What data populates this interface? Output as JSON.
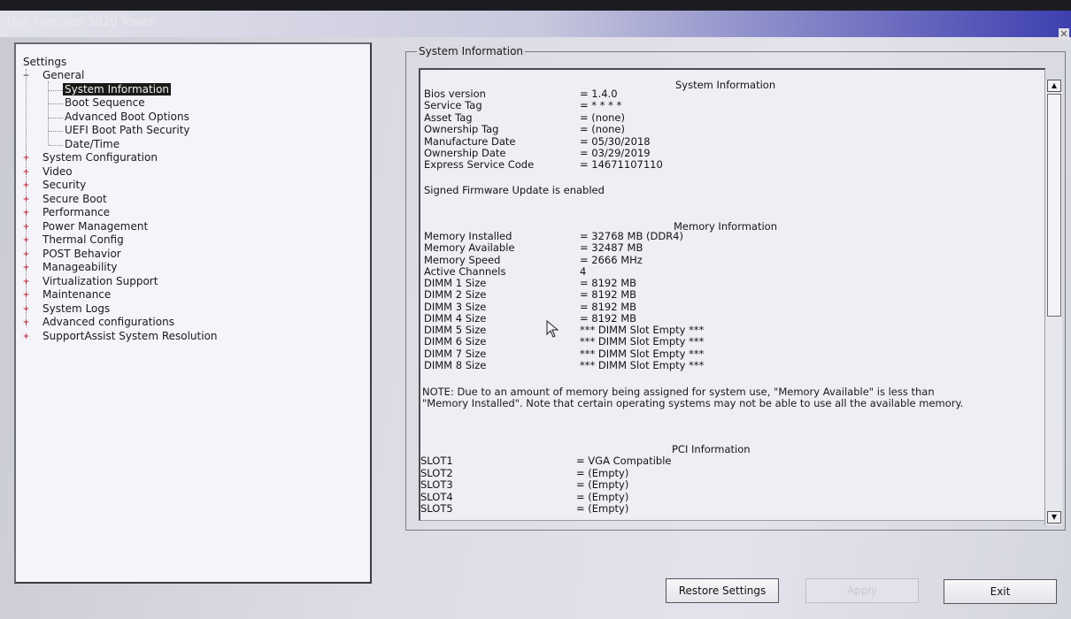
{
  "window": {
    "title": "Dell Precision 5820 Tower"
  },
  "tree": {
    "root": "Settings",
    "general": {
      "label": "General",
      "children": [
        "System Information",
        "Boot Sequence",
        "Advanced Boot Options",
        "UEFI Boot Path Security",
        "Date/Time"
      ],
      "selected": "System Information"
    },
    "items": [
      "System Configuration",
      "Video",
      "Security",
      "Secure Boot",
      "Performance",
      "Power Management",
      "Thermal Config",
      "POST Behavior",
      "Manageability",
      "Virtualization Support",
      "Maintenance",
      "System Logs",
      "Advanced configurations",
      "SupportAssist System Resolution"
    ]
  },
  "group_title": "System Information",
  "system": {
    "heading": "System Information",
    "rows": [
      [
        "Bios version",
        "= 1.4.0"
      ],
      [
        "Service Tag",
        "= * * * *"
      ],
      [
        "Asset Tag",
        "= (none)"
      ],
      [
        "Ownership Tag",
        "= (none)"
      ],
      [
        "Manufacture Date",
        "= 05/30/2018"
      ],
      [
        "Ownership Date",
        "= 03/29/2019"
      ],
      [
        "Express Service Code",
        "= 14671107110"
      ]
    ],
    "firmware_note": "Signed Firmware Update is enabled"
  },
  "memory": {
    "heading": "Memory Information",
    "rows": [
      [
        "Memory Installed",
        "= 32768 MB (DDR4)"
      ],
      [
        "Memory Available",
        "= 32487 MB"
      ],
      [
        "Memory Speed",
        "= 2666 MHz"
      ],
      [
        "Active Channels",
        "4"
      ],
      [
        "DIMM 1 Size",
        "= 8192 MB"
      ],
      [
        "DIMM 2 Size",
        "= 8192 MB"
      ],
      [
        "DIMM 3 Size",
        "= 8192 MB"
      ],
      [
        "DIMM 4 Size",
        "= 8192 MB"
      ],
      [
        "DIMM 5 Size",
        "*** DIMM Slot Empty ***"
      ],
      [
        "DIMM 6 Size",
        "*** DIMM Slot Empty ***"
      ],
      [
        "DIMM 7 Size",
        "*** DIMM Slot Empty ***"
      ],
      [
        "DIMM 8 Size",
        "*** DIMM Slot Empty ***"
      ]
    ],
    "note": "NOTE: Due to an amount of memory being assigned for system use, \"Memory Available\" is less than \"Memory Installed\". Note that certain operating systems may not be able to use all the available memory."
  },
  "pci": {
    "heading": "PCI Information",
    "rows": [
      [
        "SLOT1",
        "= VGA Compatible"
      ],
      [
        "SLOT2",
        "= (Empty)"
      ],
      [
        "SLOT3",
        "= (Empty)"
      ],
      [
        "SLOT4",
        "= (Empty)"
      ],
      [
        "SLOT5",
        "= (Empty)"
      ]
    ]
  },
  "buttons": {
    "restore": "Restore Settings",
    "apply": "Apply",
    "exit": "Exit"
  },
  "icons": {
    "scroll_up": "scroll-up-icon",
    "scroll_down": "scroll-down-icon",
    "close": "close-icon",
    "cursor": "mouse-cursor-icon"
  }
}
